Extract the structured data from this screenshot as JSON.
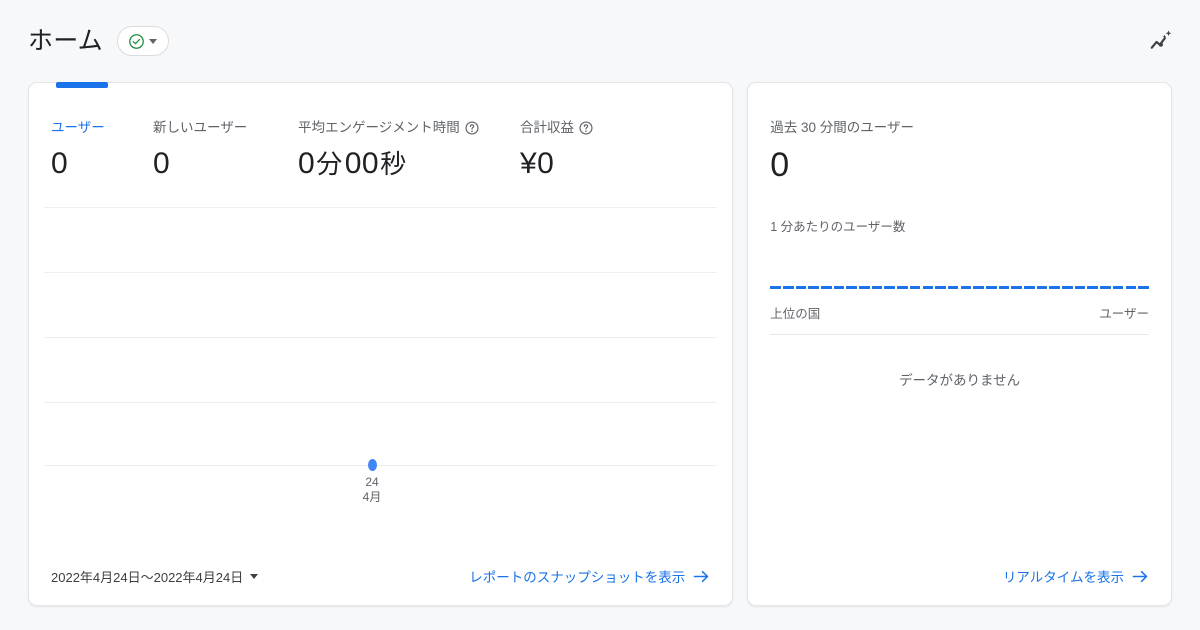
{
  "header": {
    "title": "ホーム",
    "status_icon": "check-circle-icon",
    "status_caret": "chevron-down-icon",
    "insights_icon": "insights-sparkle-icon",
    "accent_color": "#1a73e8",
    "status_color": "#1e8e3e"
  },
  "overview_card": {
    "active_tab_color": "#1a73e8",
    "metrics": [
      {
        "label": "ユーザー",
        "value": "0",
        "active": true,
        "help": false
      },
      {
        "label": "新しいユーザー",
        "value": "0",
        "active": false,
        "help": false
      },
      {
        "label": "平均エンゲージメント時間",
        "value": "0分00秒",
        "active": false,
        "help": true,
        "value_parts": {
          "num1": "0",
          "unit1": "分",
          "num2": "00",
          "unit2": "秒"
        }
      },
      {
        "label": "合計収益",
        "value": "¥0",
        "active": false,
        "help": true
      }
    ],
    "help_icon": "help-circle-icon",
    "footer": {
      "date_range": "2022年4月24日～2022年4月24日",
      "date_caret_icon": "chevron-down-icon",
      "link_label": "レポートのスナップショットを表示",
      "link_arrow_icon": "arrow-right-icon"
    }
  },
  "realtime_card": {
    "label": "過去 30 分間のユーザー",
    "value": "0",
    "sub_label": "1 分あたりのユーザー数",
    "bar_color": "#1a73e8",
    "bar_count": 30,
    "table": {
      "col_country": "上位の国",
      "col_users": "ユーザー",
      "empty_message": "データがありません"
    },
    "footer": {
      "link_label": "リアルタイムを表示",
      "link_arrow_icon": "arrow-right-icon"
    }
  },
  "chart_data": {
    "type": "line",
    "title": "",
    "xlabel": "",
    "ylabel": "",
    "x": [
      "2022-04-24"
    ],
    "tick_labels": [
      {
        "day": "24",
        "month": "4月"
      }
    ],
    "series": [
      {
        "name": "ユーザー",
        "values": [
          0
        ],
        "color": "#4285f4"
      }
    ],
    "ylim": [
      0,
      1
    ],
    "gridlines": 5,
    "grid": true,
    "legend": "none"
  }
}
